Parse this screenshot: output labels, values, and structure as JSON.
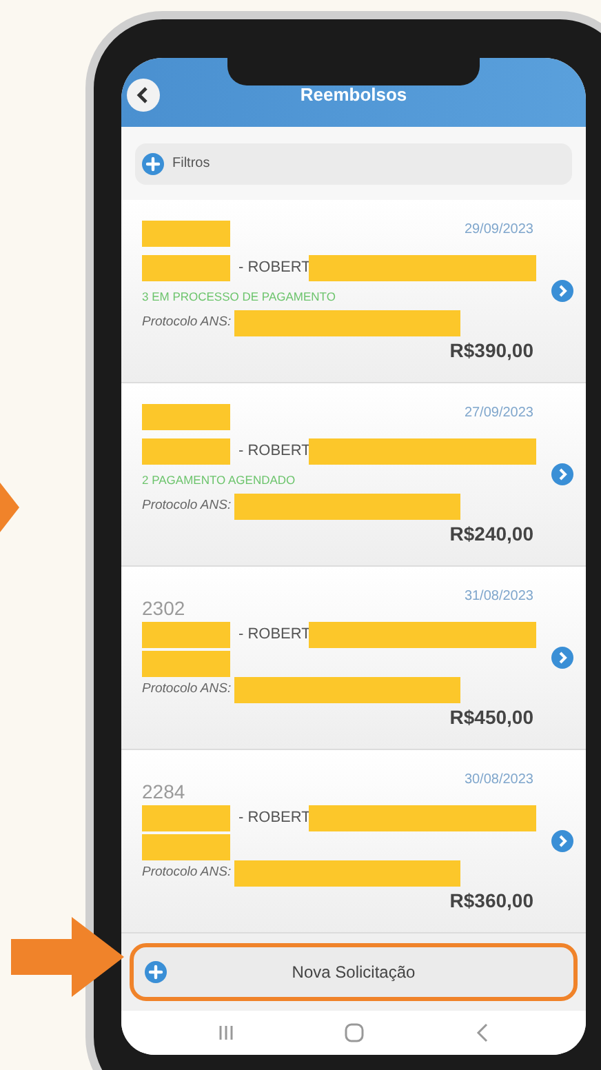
{
  "header": {
    "title": "Reembolsos"
  },
  "filter": {
    "label": "Filtros"
  },
  "cards": [
    {
      "date": "29/09/2023",
      "name": "- ROBERT",
      "status": "3 EM PROCESSO DE PAGAMENTO",
      "protocol_label": "Protocolo ANS:",
      "amount": "R$390,00"
    },
    {
      "date": "27/09/2023",
      "name": "- ROBERT",
      "status": "2 PAGAMENTO AGENDADO",
      "protocol_label": "Protocolo ANS:",
      "amount": "R$240,00"
    },
    {
      "number": "2302",
      "date": "31/08/2023",
      "name": "- ROBERT",
      "protocol_label": "Protocolo ANS:",
      "amount": "R$450,00"
    },
    {
      "number": "2284",
      "date": "30/08/2023",
      "name": "- ROBERT",
      "protocol_label": "Protocolo ANS:",
      "amount": "R$360,00"
    }
  ],
  "new_request": {
    "label": "Nova Solicitação",
    "highlighted": true
  }
}
